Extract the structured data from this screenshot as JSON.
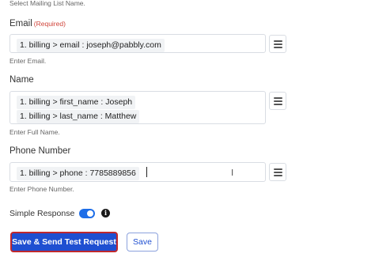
{
  "mailing_list_hint": "Select Mailing List Name.",
  "email": {
    "label": "Email",
    "required": "(Required)",
    "value": "1. billing > email : joseph@pabbly.com",
    "hint": "Enter Email."
  },
  "name": {
    "label": "Name",
    "values": [
      "1. billing > first_name : Joseph",
      "1. billing > last_name : Matthew"
    ],
    "hint": "Enter Full Name."
  },
  "phone": {
    "label": "Phone Number",
    "value": "1. billing > phone : 7785889856",
    "hint": "Enter Phone Number."
  },
  "simple_response": {
    "label": "Simple Response",
    "enabled": true,
    "info_glyph": "i"
  },
  "buttons": {
    "save_send": "Save & Send Test Request",
    "save": "Save"
  },
  "icons": {
    "menu": "hamburger-menu-icon",
    "info": "info-icon",
    "cursor": "text-cursor-icon"
  },
  "colors": {
    "primary": "#1f4fd1",
    "toggle": "#1e6ee8",
    "highlight_border": "#c0282d",
    "required": "#d0443a"
  }
}
